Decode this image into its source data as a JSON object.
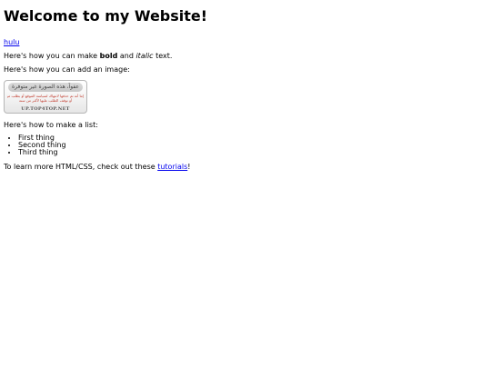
{
  "page": {
    "heading": "Welcome to my Website!",
    "link_text": "hulu",
    "bold_sentence": {
      "prefix": "Here's how you can make ",
      "bold_word": "bold",
      "middle": " and ",
      "italic_word": "italic",
      "suffix": " text."
    },
    "image_intro": "Here's how you can add an image:",
    "image": {
      "title_bar": "عفواً، هذه الصورة غير متوفرة",
      "line1": "إما أنه تم حذفها لانتهاك لسياسة الموقع أو بطلب من قبل صاحبها",
      "line2": "أو توقف الطلب عليها لأكثر من سنة",
      "url": "UP.TOP4TOP.NET"
    },
    "list_intro": "Here's how to make a list:",
    "list_items": [
      "First thing",
      "Second thing",
      "Third thing"
    ],
    "learn_more": {
      "prefix": "To learn more HTML/CSS, check out these ",
      "link_text": "tutorials",
      "suffix": "!"
    }
  }
}
